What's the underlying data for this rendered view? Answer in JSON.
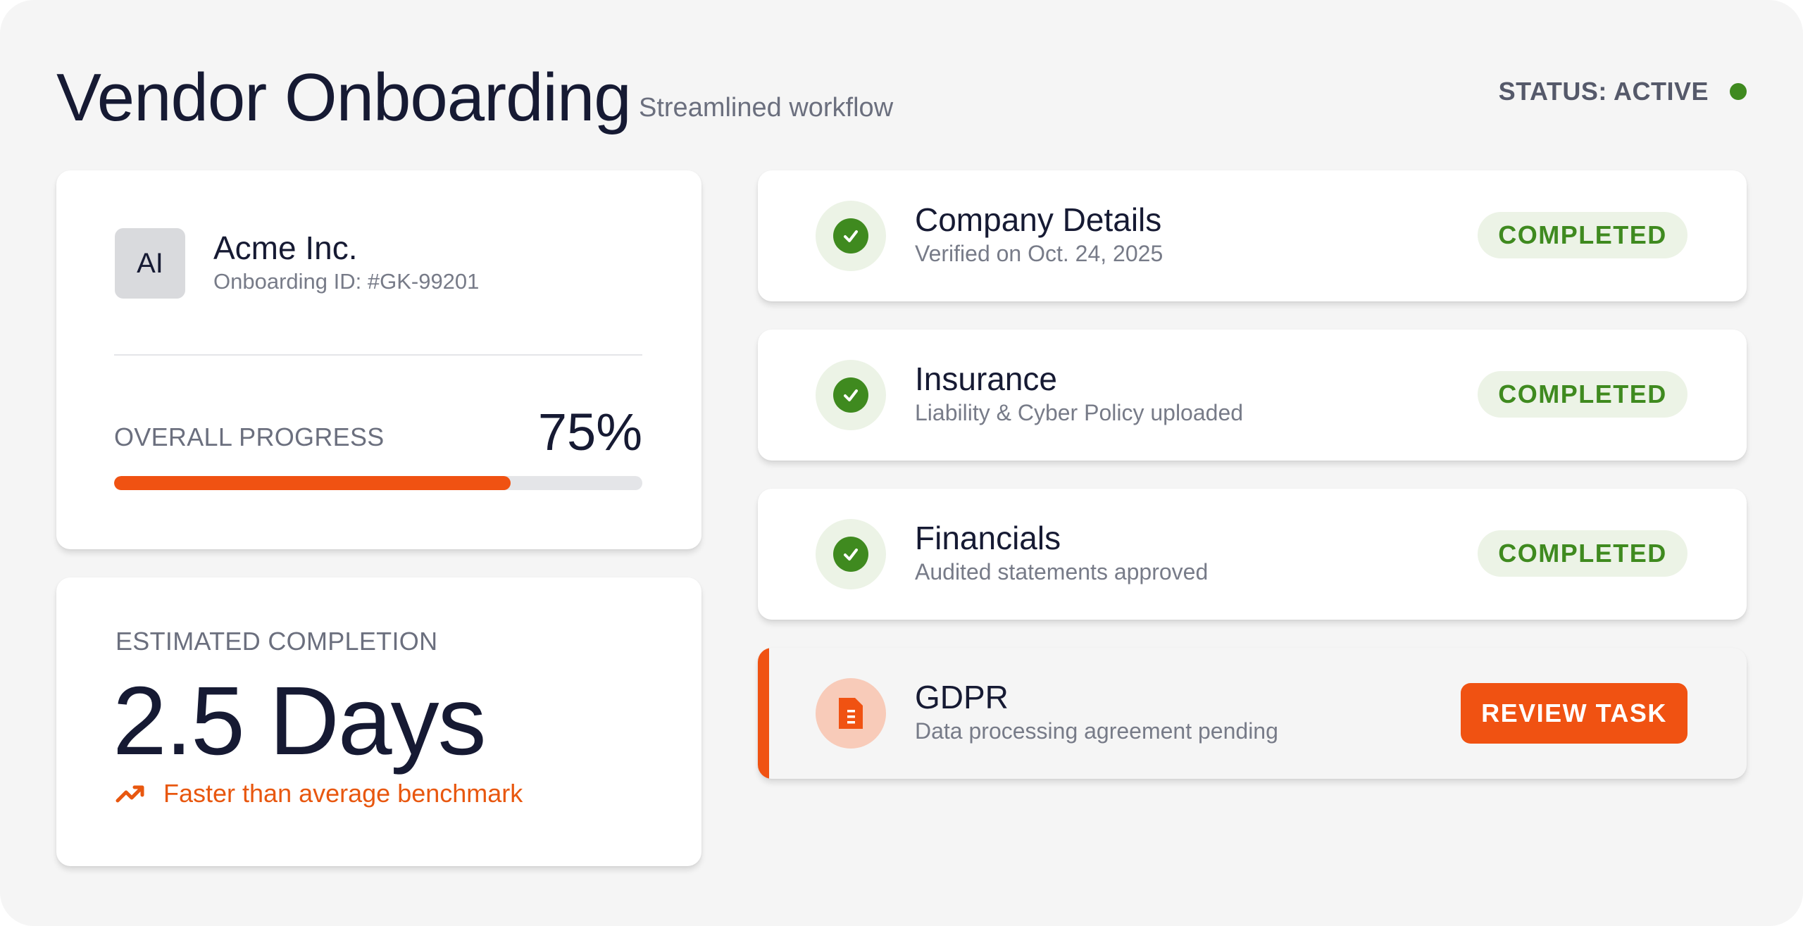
{
  "header": {
    "title": "Vendor Onboarding",
    "subtitle": "Streamlined workflow",
    "status_label": "STATUS: ACTIVE",
    "status_color": "#3f8a1f"
  },
  "vendor": {
    "avatar_initials": "AI",
    "name": "Acme Inc.",
    "onboarding_id": "Onboarding ID: #GK-99201",
    "progress_label": "OVERALL PROGRESS",
    "progress_text": "75%",
    "progress_value": 75
  },
  "estimate": {
    "label": "ESTIMATED COMPLETION",
    "value": "2.5 Days",
    "note": "Faster than average benchmark",
    "note_icon": "trending-up-icon"
  },
  "tasks": [
    {
      "title": "Company Details",
      "description": "Verified on Oct. 24, 2025",
      "status": "COMPLETED",
      "icon": "check-circle-icon"
    },
    {
      "title": "Insurance",
      "description": "Liability & Cyber Policy uploaded",
      "status": "COMPLETED",
      "icon": "check-circle-icon"
    },
    {
      "title": "Financials",
      "description": "Audited statements approved",
      "status": "COMPLETED",
      "icon": "check-circle-icon"
    },
    {
      "title": "GDPR",
      "description": "Data processing agreement pending",
      "action_label": "REVIEW TASK",
      "icon": "document-icon"
    }
  ],
  "colors": {
    "accent": "#f05212",
    "success": "#3f8a1f",
    "success_bg": "#ecf3e6",
    "text_primary": "#161a33",
    "text_secondary": "#6b6f7e",
    "background": "#f5f5f5"
  }
}
